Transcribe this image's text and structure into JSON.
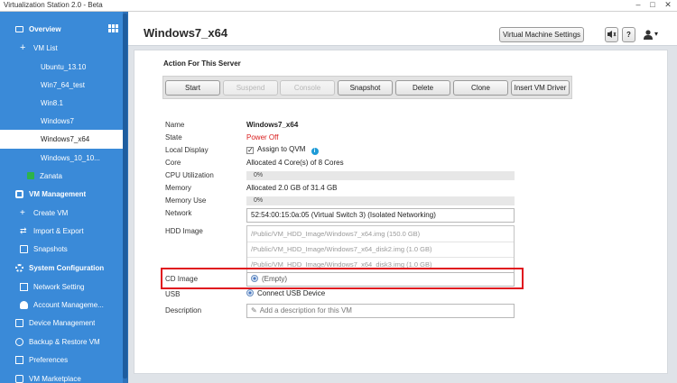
{
  "window": {
    "title": "Virtualization Station 2.0 - Beta",
    "minimize": "–",
    "maximize": "□",
    "close": "✕"
  },
  "colors": {
    "sidebar_bg": "#3a8ad8",
    "highlight": "#e0141e",
    "power_off": "#d91c1c",
    "vm_green": "#2db34a"
  },
  "sidebar": {
    "overview": "Overview",
    "vm_list": "VM List",
    "vms": [
      {
        "label": "Ubuntu_13.10",
        "icon": "vm-windows-icon"
      },
      {
        "label": "Win7_64_test",
        "icon": "vm-windows-icon"
      },
      {
        "label": "Win8.1",
        "icon": "vm-windows-icon"
      },
      {
        "label": "Windows7",
        "icon": "vm-windows-icon"
      },
      {
        "label": "Windows7_x64",
        "icon": "vm-windows-icon",
        "selected": true
      },
      {
        "label": "Windows_10_10...",
        "icon": "vm-windows-icon"
      },
      {
        "label": "Zanata",
        "icon": "vm-running-icon"
      }
    ],
    "vm_management": "VM Management",
    "create_vm": "Create VM",
    "import_export": "Import & Export",
    "snapshots": "Snapshots",
    "system_configuration": "System Configuration",
    "network_setting": "Network Setting",
    "account_management": "Account Manageme...",
    "device_management": "Device Management",
    "backup_restore": "Backup & Restore VM",
    "preferences": "Preferences",
    "vm_marketplace": "VM Marketplace"
  },
  "header": {
    "vm_name": "Windows7_x64",
    "settings_button": "Virtual Machine Settings",
    "help": "?",
    "user": "▾"
  },
  "actions": {
    "title": "Action For This Server",
    "start": "Start",
    "suspend": "Suspend",
    "console": "Console",
    "snapshot": "Snapshot",
    "delete": "Delete",
    "clone": "Clone",
    "insert_driver": "Insert VM Driver"
  },
  "details": {
    "name_label": "Name",
    "name": "Windows7_x64",
    "state_label": "State",
    "state": "Power Off",
    "local_display_label": "Local Display",
    "local_display": "Assign to QVM",
    "core_label": "Core",
    "core": "Allocated 4 Core(s) of 8 Cores",
    "cpu_label": "CPU Utilization",
    "cpu": "0%",
    "memory_label": "Memory",
    "memory": "Allocated 2.0 GB of 31.4 GB",
    "memory_use_label": "Memory Use",
    "memory_use": "0%",
    "network_label": "Network",
    "network": "52:54:00:15:0a:05 (Virtual Switch 3) (Isolated Networking)",
    "hdd_label": "HDD Image",
    "hdd_images": [
      "/Public/VM_HDD_Image/Windows7_x64.img (150.0 GB)",
      "/Public/VM_HDD_Image/Windows7_x64_disk2.img (1.0 GB)",
      "/Public/VM_HDD_Image/Windows7_x64_disk3.img (1.0 GB)"
    ],
    "cd_label": "CD Image",
    "cd": "(Empty)",
    "usb_label": "USB",
    "usb": "Connect USB Device",
    "description_label": "Description",
    "description_placeholder": "Add a description for this VM"
  }
}
